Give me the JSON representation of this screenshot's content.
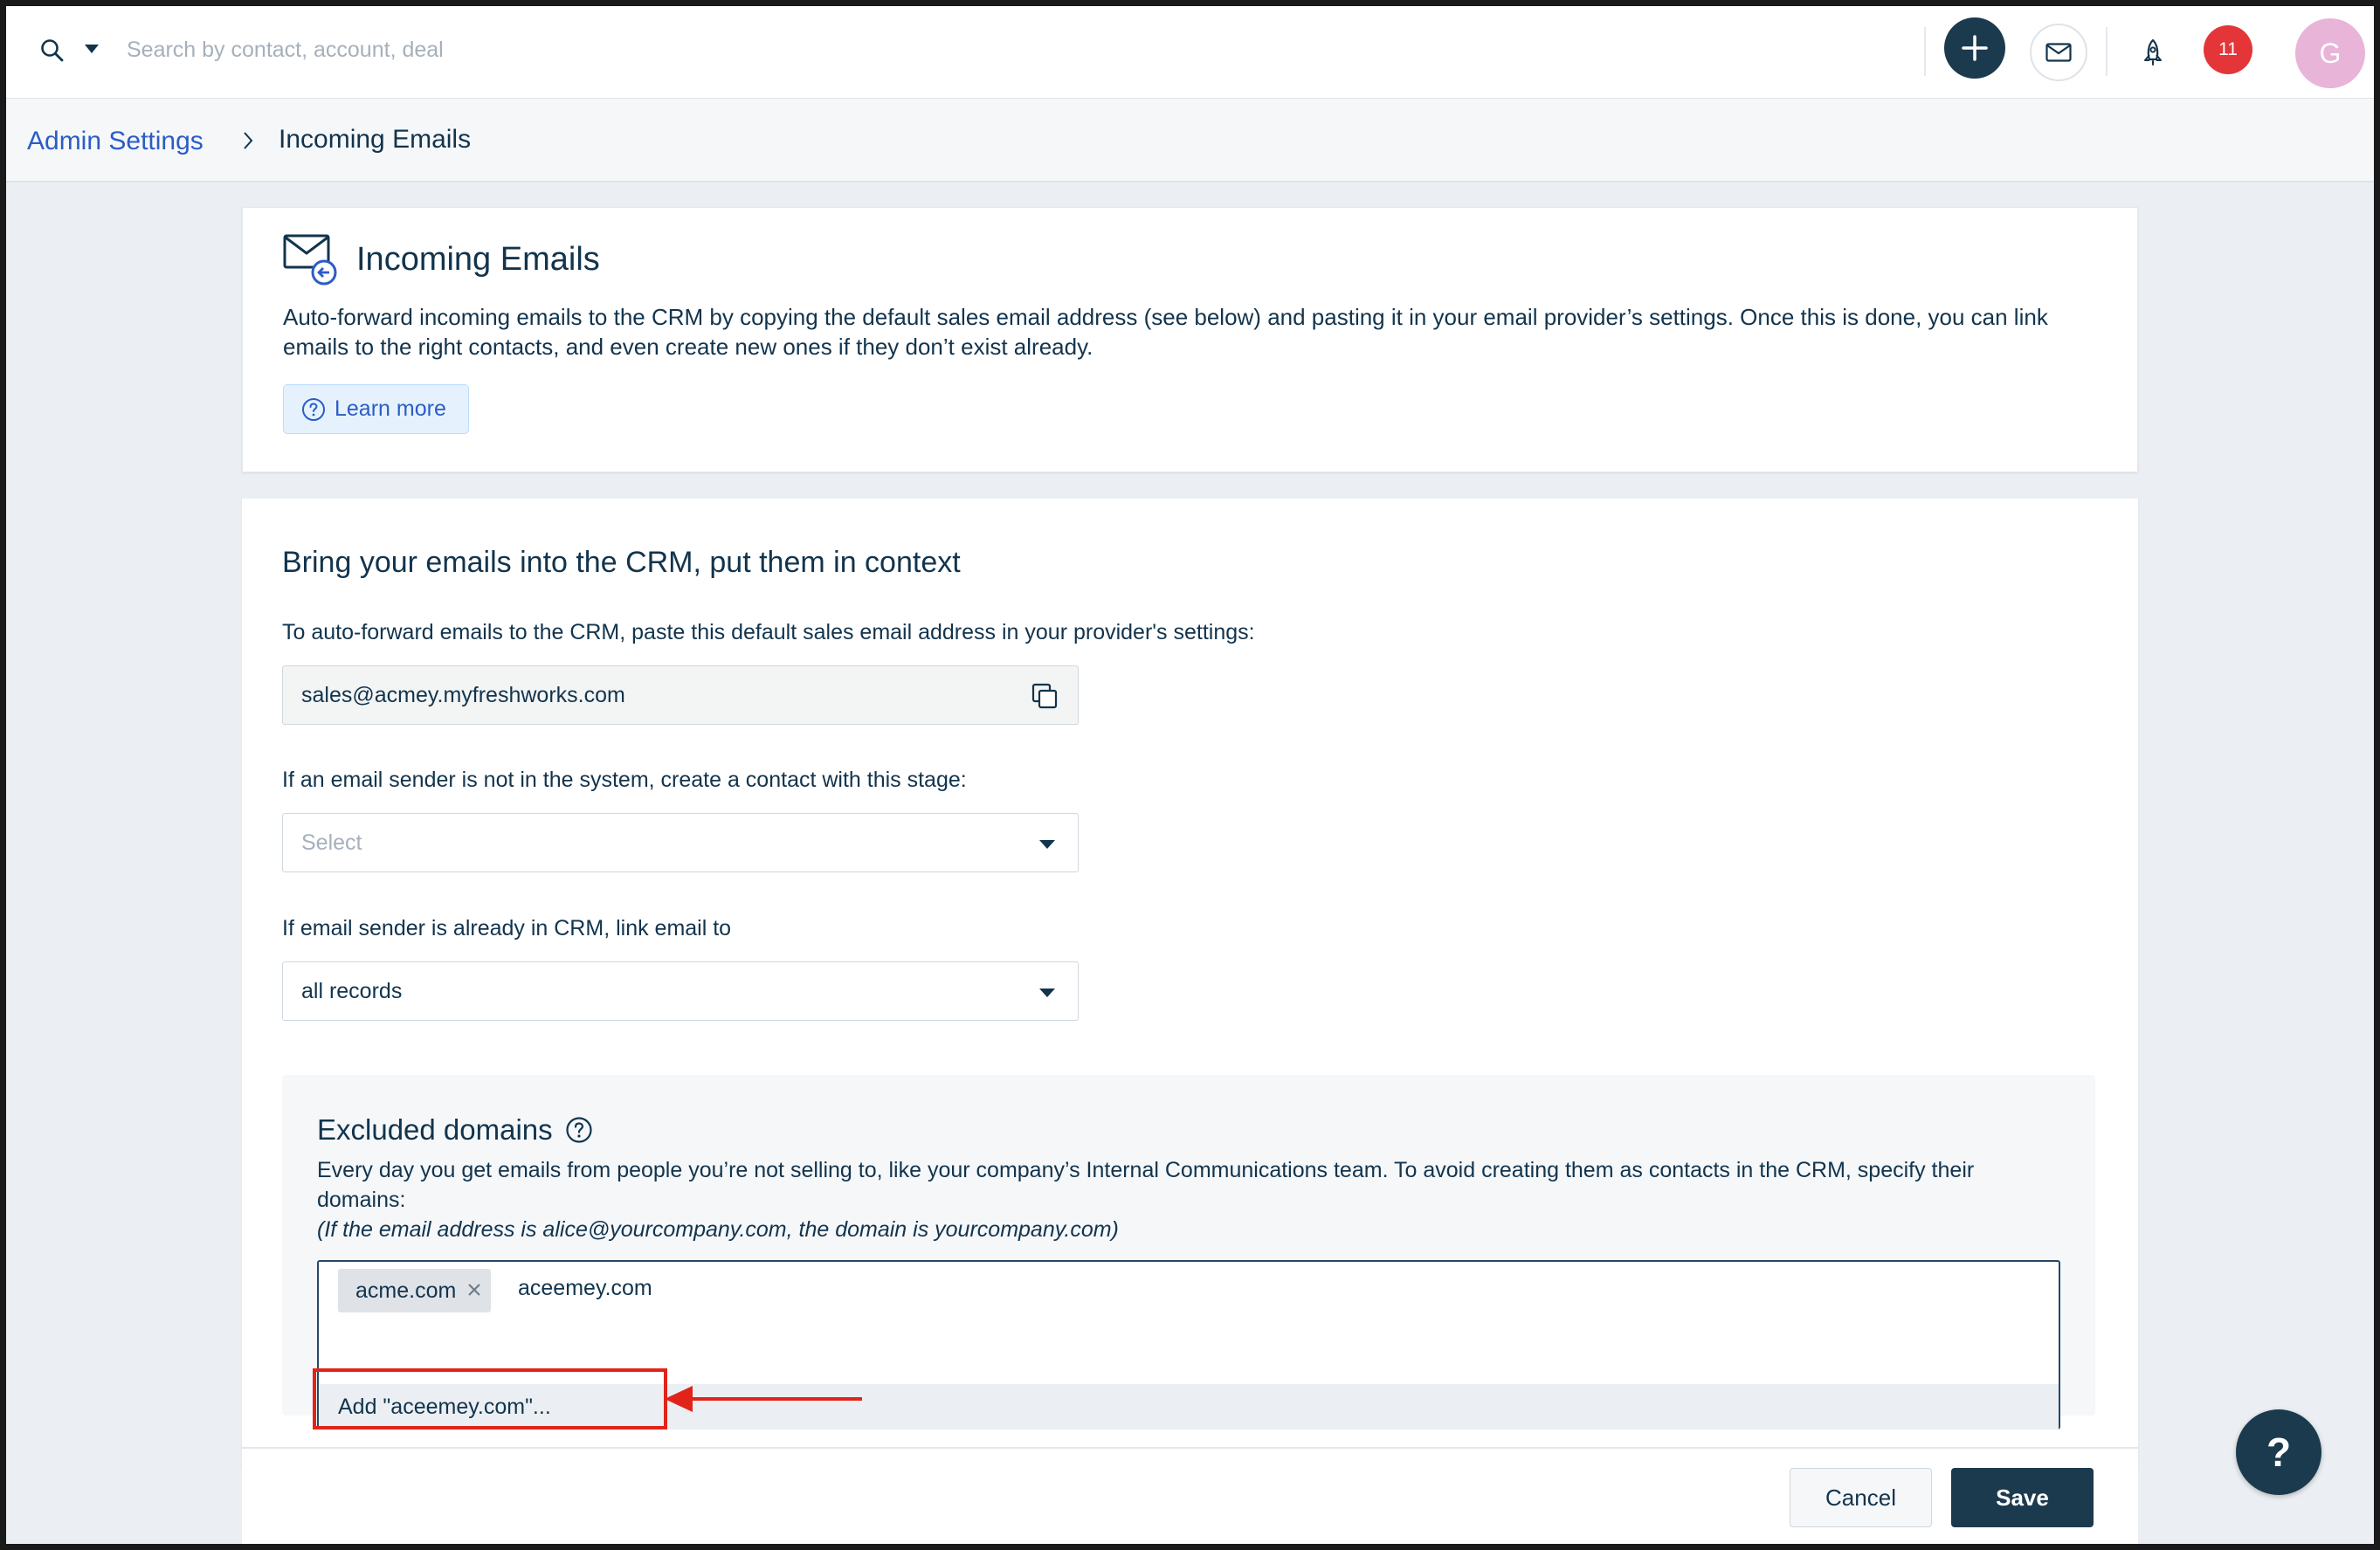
{
  "topbar": {
    "search_placeholder": "Search by contact, account, deal",
    "notification_count": "11",
    "avatar_initial": "G"
  },
  "breadcrumb": {
    "parent": "Admin Settings",
    "current": "Incoming Emails"
  },
  "header_card": {
    "title": "Incoming Emails",
    "description": "Auto-forward incoming emails to the CRM by copying the default sales email address (see below) and pasting it in your email provider’s settings. Once this is done, you can link emails to the right contacts, and even create new ones if they don’t exist already.",
    "learn_more": "Learn more"
  },
  "settings": {
    "section_title": "Bring your emails into the CRM, put them in context",
    "forward_label": "To auto-forward emails to the CRM, paste this default sales email address in your provider's settings:",
    "sales_email": "sales@acmey.myfreshworks.com",
    "stage_label": "If an email sender is not in the system, create a contact with this stage:",
    "stage_placeholder": "Select",
    "link_label": "If email sender is already in CRM, link email to",
    "link_value": "all records"
  },
  "excluded_domains": {
    "title": "Excluded domains",
    "description": "Every day you get emails from people you’re not selling to, like your company’s Internal Communications team. To avoid creating them as contacts in the CRM, specify their domains:",
    "note": "(If the email address is alice@yourcompany.com, the domain is yourcompany.com)",
    "tags": [
      "acme.com"
    ],
    "typed_value": "aceemey.com",
    "suggestion": "Add \"aceemey.com\"..."
  },
  "footer": {
    "cancel": "Cancel",
    "save": "Save"
  },
  "help_fab": "?",
  "colors": {
    "primary_dark": "#1b3a4e",
    "link_blue": "#2c5cc5",
    "annotation_red": "#e2231a",
    "notification_red": "#e43538"
  }
}
